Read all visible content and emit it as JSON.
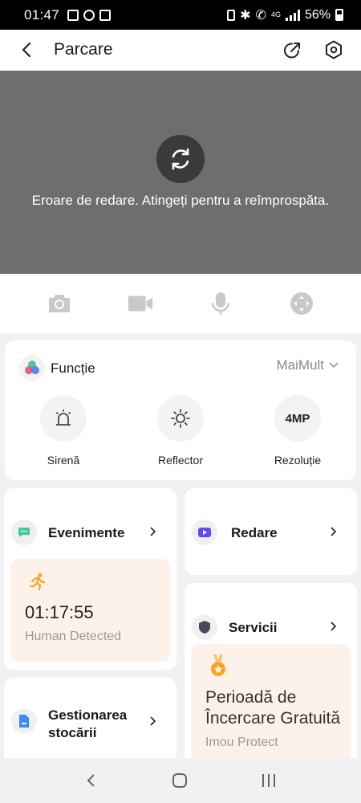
{
  "status_bar": {
    "time": "01:47",
    "battery": "56%",
    "network": "4G"
  },
  "header": {
    "title": "Parcare"
  },
  "video": {
    "error_message": "Eroare de redare. Atingeți pentru a reîmprospăta."
  },
  "controls": [
    "camera-icon",
    "video-record-icon",
    "microphone-icon",
    "ptz-control-icon"
  ],
  "functions": {
    "title": "Funcție",
    "more_label": "MaiMult",
    "items": [
      {
        "label": "Sirenă",
        "icon": "siren-icon"
      },
      {
        "label": "Reflector",
        "icon": "sun-icon"
      },
      {
        "label": "Rezoluție",
        "badge": "4MP"
      }
    ]
  },
  "events": {
    "title": "Evenimente",
    "latest_time": "01:17:55",
    "latest_type": "Human Detected"
  },
  "playback": {
    "title": "Redare"
  },
  "services": {
    "title": "Servicii",
    "trial_title": "Perioadă de Încercare Gratuită",
    "trial_subtitle": "Imou Protect"
  },
  "storage": {
    "title": "Gestionarea stocării"
  },
  "colors": {
    "accent": "#f5a623",
    "event_bg": "#fdf2ea",
    "video_bg": "#6e6e6e"
  }
}
